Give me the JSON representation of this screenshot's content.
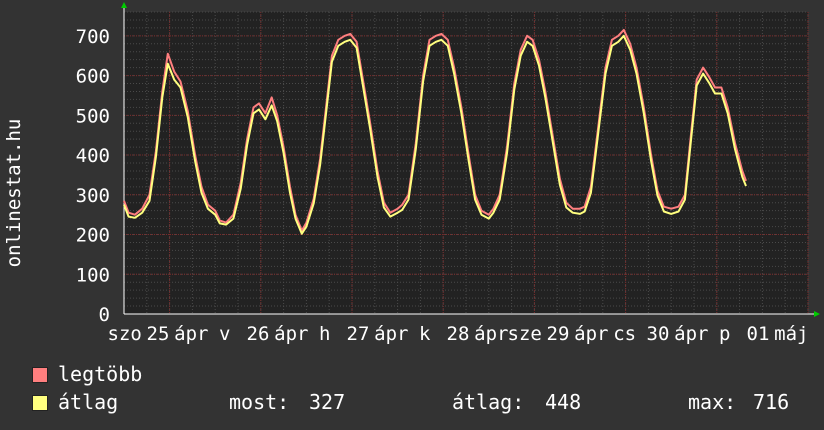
{
  "chart_data": {
    "type": "line",
    "ylabel": "onlinestat.hu",
    "ylim": [
      0,
      760
    ],
    "yticks": [
      0,
      100,
      200,
      300,
      400,
      500,
      600,
      700
    ],
    "grid": true,
    "xrange": [
      0,
      7.5
    ],
    "xtick_labels": [
      "szo",
      "25",
      "ápr",
      "v",
      "26",
      "ápr",
      "h",
      "27",
      "ápr",
      "k",
      "28",
      "ápr",
      "sze",
      "29",
      "ápr",
      "cs",
      "30",
      "ápr",
      "p",
      "01",
      "máj"
    ],
    "series": [
      {
        "name": "legtöbb",
        "color": "#ff7f7f",
        "points": [
          [
            0.0,
            285
          ],
          [
            0.05,
            255
          ],
          [
            0.12,
            250
          ],
          [
            0.2,
            265
          ],
          [
            0.28,
            300
          ],
          [
            0.35,
            410
          ],
          [
            0.42,
            560
          ],
          [
            0.48,
            655
          ],
          [
            0.55,
            610
          ],
          [
            0.62,
            585
          ],
          [
            0.7,
            510
          ],
          [
            0.78,
            400
          ],
          [
            0.85,
            320
          ],
          [
            0.92,
            275
          ],
          [
            1.0,
            260
          ],
          [
            1.05,
            235
          ],
          [
            1.12,
            230
          ],
          [
            1.2,
            250
          ],
          [
            1.28,
            330
          ],
          [
            1.35,
            440
          ],
          [
            1.42,
            520
          ],
          [
            1.48,
            530
          ],
          [
            1.55,
            505
          ],
          [
            1.62,
            545
          ],
          [
            1.68,
            500
          ],
          [
            1.75,
            420
          ],
          [
            1.82,
            320
          ],
          [
            1.88,
            250
          ],
          [
            1.95,
            210
          ],
          [
            2.0,
            230
          ],
          [
            2.08,
            290
          ],
          [
            2.15,
            390
          ],
          [
            2.22,
            530
          ],
          [
            2.28,
            650
          ],
          [
            2.35,
            690
          ],
          [
            2.42,
            700
          ],
          [
            2.48,
            705
          ],
          [
            2.55,
            685
          ],
          [
            2.62,
            590
          ],
          [
            2.7,
            480
          ],
          [
            2.78,
            360
          ],
          [
            2.85,
            280
          ],
          [
            2.92,
            255
          ],
          [
            3.0,
            265
          ],
          [
            3.05,
            275
          ],
          [
            3.12,
            300
          ],
          [
            3.2,
            430
          ],
          [
            3.28,
            600
          ],
          [
            3.35,
            690
          ],
          [
            3.42,
            700
          ],
          [
            3.48,
            705
          ],
          [
            3.55,
            690
          ],
          [
            3.62,
            620
          ],
          [
            3.7,
            520
          ],
          [
            3.78,
            400
          ],
          [
            3.85,
            300
          ],
          [
            3.92,
            260
          ],
          [
            4.0,
            250
          ],
          [
            4.05,
            265
          ],
          [
            4.12,
            300
          ],
          [
            4.2,
            420
          ],
          [
            4.28,
            580
          ],
          [
            4.35,
            665
          ],
          [
            4.42,
            700
          ],
          [
            4.48,
            690
          ],
          [
            4.55,
            640
          ],
          [
            4.62,
            560
          ],
          [
            4.7,
            450
          ],
          [
            4.78,
            340
          ],
          [
            4.85,
            280
          ],
          [
            4.92,
            265
          ],
          [
            5.0,
            265
          ],
          [
            5.05,
            270
          ],
          [
            5.12,
            320
          ],
          [
            5.2,
            470
          ],
          [
            5.28,
            620
          ],
          [
            5.35,
            690
          ],
          [
            5.42,
            700
          ],
          [
            5.48,
            715
          ],
          [
            5.55,
            680
          ],
          [
            5.62,
            620
          ],
          [
            5.7,
            520
          ],
          [
            5.78,
            400
          ],
          [
            5.85,
            310
          ],
          [
            5.92,
            270
          ],
          [
            6.0,
            265
          ],
          [
            6.08,
            270
          ],
          [
            6.15,
            300
          ],
          [
            6.22,
            460
          ],
          [
            6.28,
            590
          ],
          [
            6.35,
            620
          ],
          [
            6.42,
            595
          ],
          [
            6.48,
            570
          ],
          [
            6.55,
            570
          ],
          [
            6.62,
            520
          ],
          [
            6.7,
            430
          ],
          [
            6.78,
            360
          ],
          [
            6.82,
            335
          ]
        ]
      },
      {
        "name": "átlag",
        "color": "#ffff7f",
        "points": [
          [
            0.0,
            275
          ],
          [
            0.05,
            245
          ],
          [
            0.12,
            242
          ],
          [
            0.2,
            255
          ],
          [
            0.28,
            285
          ],
          [
            0.35,
            395
          ],
          [
            0.42,
            545
          ],
          [
            0.48,
            630
          ],
          [
            0.55,
            590
          ],
          [
            0.62,
            570
          ],
          [
            0.7,
            495
          ],
          [
            0.78,
            385
          ],
          [
            0.85,
            305
          ],
          [
            0.92,
            265
          ],
          [
            1.0,
            250
          ],
          [
            1.05,
            228
          ],
          [
            1.12,
            225
          ],
          [
            1.2,
            240
          ],
          [
            1.28,
            315
          ],
          [
            1.35,
            425
          ],
          [
            1.42,
            505
          ],
          [
            1.48,
            515
          ],
          [
            1.55,
            490
          ],
          [
            1.62,
            525
          ],
          [
            1.68,
            485
          ],
          [
            1.75,
            405
          ],
          [
            1.82,
            305
          ],
          [
            1.88,
            240
          ],
          [
            1.95,
            202
          ],
          [
            2.0,
            220
          ],
          [
            2.08,
            278
          ],
          [
            2.15,
            375
          ],
          [
            2.22,
            515
          ],
          [
            2.28,
            635
          ],
          [
            2.35,
            675
          ],
          [
            2.42,
            685
          ],
          [
            2.48,
            690
          ],
          [
            2.55,
            670
          ],
          [
            2.62,
            575
          ],
          [
            2.7,
            465
          ],
          [
            2.78,
            345
          ],
          [
            2.85,
            268
          ],
          [
            2.92,
            245
          ],
          [
            3.0,
            255
          ],
          [
            3.05,
            262
          ],
          [
            3.12,
            288
          ],
          [
            3.2,
            415
          ],
          [
            3.28,
            585
          ],
          [
            3.35,
            675
          ],
          [
            3.42,
            685
          ],
          [
            3.48,
            690
          ],
          [
            3.55,
            675
          ],
          [
            3.62,
            605
          ],
          [
            3.7,
            505
          ],
          [
            3.78,
            385
          ],
          [
            3.85,
            288
          ],
          [
            3.92,
            250
          ],
          [
            4.0,
            240
          ],
          [
            4.05,
            255
          ],
          [
            4.12,
            288
          ],
          [
            4.2,
            405
          ],
          [
            4.28,
            565
          ],
          [
            4.35,
            650
          ],
          [
            4.42,
            685
          ],
          [
            4.48,
            675
          ],
          [
            4.55,
            625
          ],
          [
            4.62,
            545
          ],
          [
            4.7,
            435
          ],
          [
            4.78,
            325
          ],
          [
            4.85,
            268
          ],
          [
            4.92,
            255
          ],
          [
            5.0,
            252
          ],
          [
            5.05,
            258
          ],
          [
            5.12,
            305
          ],
          [
            5.2,
            455
          ],
          [
            5.28,
            605
          ],
          [
            5.35,
            675
          ],
          [
            5.42,
            685
          ],
          [
            5.48,
            700
          ],
          [
            5.55,
            665
          ],
          [
            5.62,
            605
          ],
          [
            5.7,
            505
          ],
          [
            5.78,
            385
          ],
          [
            5.85,
            298
          ],
          [
            5.92,
            258
          ],
          [
            6.0,
            252
          ],
          [
            6.08,
            258
          ],
          [
            6.15,
            288
          ],
          [
            6.22,
            445
          ],
          [
            6.28,
            575
          ],
          [
            6.35,
            605
          ],
          [
            6.42,
            580
          ],
          [
            6.48,
            555
          ],
          [
            6.55,
            555
          ],
          [
            6.62,
            505
          ],
          [
            6.7,
            415
          ],
          [
            6.78,
            345
          ],
          [
            6.82,
            322
          ]
        ]
      }
    ],
    "stats": {
      "most_label": "most:",
      "most_value": "327",
      "atlag_label": "átlag:",
      "atlag_value": "448",
      "max_label": "max:",
      "max_value": "716"
    },
    "colors": {
      "background": "#333333",
      "plot_background": "#222222",
      "grid_minor": "#4a4a4a",
      "grid_major": "#7a2a2a",
      "axis": "#ffffff",
      "arrow": "#00cc00"
    }
  }
}
